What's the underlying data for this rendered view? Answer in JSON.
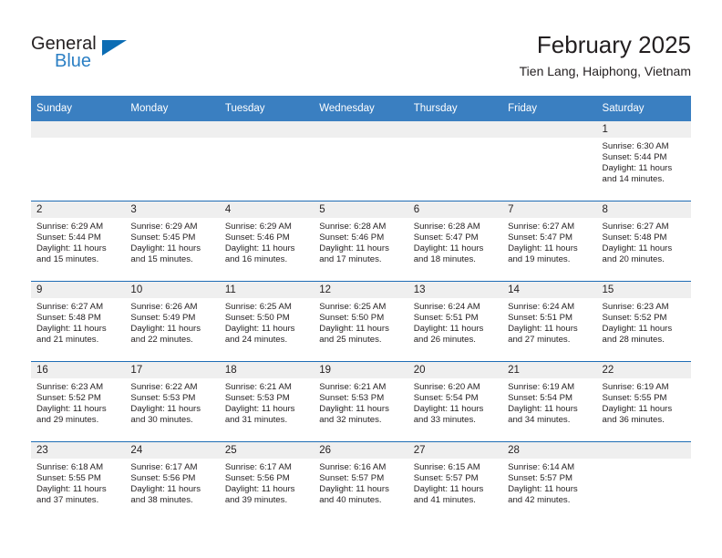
{
  "brand": {
    "name_part1": "General",
    "name_part2": "Blue",
    "accent_color": "#0b6cb4",
    "logo_icon": "triangle-icon"
  },
  "header": {
    "title": "February 2025",
    "subtitle": "Tien Lang, Haiphong, Vietnam"
  },
  "theme": {
    "header_bar_color": "#3a7fc1",
    "row_divider_color": "#1f6db5",
    "daynum_strip_color": "#efefef",
    "text_color": "#231f20"
  },
  "weekday_headers": [
    "Sunday",
    "Monday",
    "Tuesday",
    "Wednesday",
    "Thursday",
    "Friday",
    "Saturday"
  ],
  "weeks": [
    [
      {
        "day": "",
        "sunrise": "",
        "sunset": "",
        "daylight_line1": "",
        "daylight_line2": ""
      },
      {
        "day": "",
        "sunrise": "",
        "sunset": "",
        "daylight_line1": "",
        "daylight_line2": ""
      },
      {
        "day": "",
        "sunrise": "",
        "sunset": "",
        "daylight_line1": "",
        "daylight_line2": ""
      },
      {
        "day": "",
        "sunrise": "",
        "sunset": "",
        "daylight_line1": "",
        "daylight_line2": ""
      },
      {
        "day": "",
        "sunrise": "",
        "sunset": "",
        "daylight_line1": "",
        "daylight_line2": ""
      },
      {
        "day": "",
        "sunrise": "",
        "sunset": "",
        "daylight_line1": "",
        "daylight_line2": ""
      },
      {
        "day": "1",
        "sunrise": "Sunrise: 6:30 AM",
        "sunset": "Sunset: 5:44 PM",
        "daylight_line1": "Daylight: 11 hours",
        "daylight_line2": "and 14 minutes."
      }
    ],
    [
      {
        "day": "2",
        "sunrise": "Sunrise: 6:29 AM",
        "sunset": "Sunset: 5:44 PM",
        "daylight_line1": "Daylight: 11 hours",
        "daylight_line2": "and 15 minutes."
      },
      {
        "day": "3",
        "sunrise": "Sunrise: 6:29 AM",
        "sunset": "Sunset: 5:45 PM",
        "daylight_line1": "Daylight: 11 hours",
        "daylight_line2": "and 15 minutes."
      },
      {
        "day": "4",
        "sunrise": "Sunrise: 6:29 AM",
        "sunset": "Sunset: 5:46 PM",
        "daylight_line1": "Daylight: 11 hours",
        "daylight_line2": "and 16 minutes."
      },
      {
        "day": "5",
        "sunrise": "Sunrise: 6:28 AM",
        "sunset": "Sunset: 5:46 PM",
        "daylight_line1": "Daylight: 11 hours",
        "daylight_line2": "and 17 minutes."
      },
      {
        "day": "6",
        "sunrise": "Sunrise: 6:28 AM",
        "sunset": "Sunset: 5:47 PM",
        "daylight_line1": "Daylight: 11 hours",
        "daylight_line2": "and 18 minutes."
      },
      {
        "day": "7",
        "sunrise": "Sunrise: 6:27 AM",
        "sunset": "Sunset: 5:47 PM",
        "daylight_line1": "Daylight: 11 hours",
        "daylight_line2": "and 19 minutes."
      },
      {
        "day": "8",
        "sunrise": "Sunrise: 6:27 AM",
        "sunset": "Sunset: 5:48 PM",
        "daylight_line1": "Daylight: 11 hours",
        "daylight_line2": "and 20 minutes."
      }
    ],
    [
      {
        "day": "9",
        "sunrise": "Sunrise: 6:27 AM",
        "sunset": "Sunset: 5:48 PM",
        "daylight_line1": "Daylight: 11 hours",
        "daylight_line2": "and 21 minutes."
      },
      {
        "day": "10",
        "sunrise": "Sunrise: 6:26 AM",
        "sunset": "Sunset: 5:49 PM",
        "daylight_line1": "Daylight: 11 hours",
        "daylight_line2": "and 22 minutes."
      },
      {
        "day": "11",
        "sunrise": "Sunrise: 6:25 AM",
        "sunset": "Sunset: 5:50 PM",
        "daylight_line1": "Daylight: 11 hours",
        "daylight_line2": "and 24 minutes."
      },
      {
        "day": "12",
        "sunrise": "Sunrise: 6:25 AM",
        "sunset": "Sunset: 5:50 PM",
        "daylight_line1": "Daylight: 11 hours",
        "daylight_line2": "and 25 minutes."
      },
      {
        "day": "13",
        "sunrise": "Sunrise: 6:24 AM",
        "sunset": "Sunset: 5:51 PM",
        "daylight_line1": "Daylight: 11 hours",
        "daylight_line2": "and 26 minutes."
      },
      {
        "day": "14",
        "sunrise": "Sunrise: 6:24 AM",
        "sunset": "Sunset: 5:51 PM",
        "daylight_line1": "Daylight: 11 hours",
        "daylight_line2": "and 27 minutes."
      },
      {
        "day": "15",
        "sunrise": "Sunrise: 6:23 AM",
        "sunset": "Sunset: 5:52 PM",
        "daylight_line1": "Daylight: 11 hours",
        "daylight_line2": "and 28 minutes."
      }
    ],
    [
      {
        "day": "16",
        "sunrise": "Sunrise: 6:23 AM",
        "sunset": "Sunset: 5:52 PM",
        "daylight_line1": "Daylight: 11 hours",
        "daylight_line2": "and 29 minutes."
      },
      {
        "day": "17",
        "sunrise": "Sunrise: 6:22 AM",
        "sunset": "Sunset: 5:53 PM",
        "daylight_line1": "Daylight: 11 hours",
        "daylight_line2": "and 30 minutes."
      },
      {
        "day": "18",
        "sunrise": "Sunrise: 6:21 AM",
        "sunset": "Sunset: 5:53 PM",
        "daylight_line1": "Daylight: 11 hours",
        "daylight_line2": "and 31 minutes."
      },
      {
        "day": "19",
        "sunrise": "Sunrise: 6:21 AM",
        "sunset": "Sunset: 5:53 PM",
        "daylight_line1": "Daylight: 11 hours",
        "daylight_line2": "and 32 minutes."
      },
      {
        "day": "20",
        "sunrise": "Sunrise: 6:20 AM",
        "sunset": "Sunset: 5:54 PM",
        "daylight_line1": "Daylight: 11 hours",
        "daylight_line2": "and 33 minutes."
      },
      {
        "day": "21",
        "sunrise": "Sunrise: 6:19 AM",
        "sunset": "Sunset: 5:54 PM",
        "daylight_line1": "Daylight: 11 hours",
        "daylight_line2": "and 34 minutes."
      },
      {
        "day": "22",
        "sunrise": "Sunrise: 6:19 AM",
        "sunset": "Sunset: 5:55 PM",
        "daylight_line1": "Daylight: 11 hours",
        "daylight_line2": "and 36 minutes."
      }
    ],
    [
      {
        "day": "23",
        "sunrise": "Sunrise: 6:18 AM",
        "sunset": "Sunset: 5:55 PM",
        "daylight_line1": "Daylight: 11 hours",
        "daylight_line2": "and 37 minutes."
      },
      {
        "day": "24",
        "sunrise": "Sunrise: 6:17 AM",
        "sunset": "Sunset: 5:56 PM",
        "daylight_line1": "Daylight: 11 hours",
        "daylight_line2": "and 38 minutes."
      },
      {
        "day": "25",
        "sunrise": "Sunrise: 6:17 AM",
        "sunset": "Sunset: 5:56 PM",
        "daylight_line1": "Daylight: 11 hours",
        "daylight_line2": "and 39 minutes."
      },
      {
        "day": "26",
        "sunrise": "Sunrise: 6:16 AM",
        "sunset": "Sunset: 5:57 PM",
        "daylight_line1": "Daylight: 11 hours",
        "daylight_line2": "and 40 minutes."
      },
      {
        "day": "27",
        "sunrise": "Sunrise: 6:15 AM",
        "sunset": "Sunset: 5:57 PM",
        "daylight_line1": "Daylight: 11 hours",
        "daylight_line2": "and 41 minutes."
      },
      {
        "day": "28",
        "sunrise": "Sunrise: 6:14 AM",
        "sunset": "Sunset: 5:57 PM",
        "daylight_line1": "Daylight: 11 hours",
        "daylight_line2": "and 42 minutes."
      },
      {
        "day": "",
        "sunrise": "",
        "sunset": "",
        "daylight_line1": "",
        "daylight_line2": ""
      }
    ]
  ]
}
